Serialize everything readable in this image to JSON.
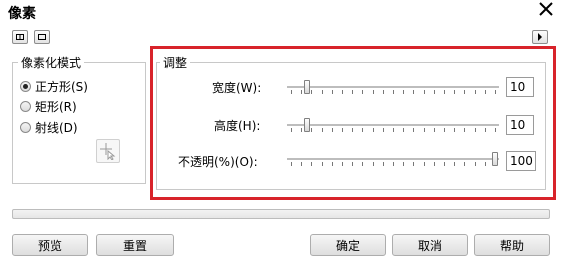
{
  "window": {
    "title": "像素",
    "close_glyph": "✕"
  },
  "toolbar": {
    "left_buttons": [
      {
        "icon": "preview-split-icon"
      },
      {
        "icon": "preview-single-icon"
      }
    ],
    "right_button": {
      "icon": "arrow-right-icon"
    }
  },
  "mode_group": {
    "title": "像素化模式",
    "options": [
      {
        "label": "正方形(S)",
        "checked": true
      },
      {
        "label": "矩形(R)",
        "checked": false
      },
      {
        "label": "射线(D)",
        "checked": false
      }
    ],
    "tool_icon": "pick-center-icon"
  },
  "adjust_group": {
    "title": "调整",
    "sliders": [
      {
        "label": "宽度(W):",
        "value": "10",
        "level": 0.08
      },
      {
        "label": "高度(H):",
        "value": "10",
        "level": 0.08
      },
      {
        "label": "不透明(%)(O):",
        "value": "100",
        "level": 1.0
      }
    ]
  },
  "progress": {
    "level": 0
  },
  "buttons": {
    "preview": "预览",
    "reset": "重置",
    "ok": "确定",
    "cancel": "取消",
    "help": "帮助"
  },
  "colors": {
    "highlight": "#d8232a"
  }
}
